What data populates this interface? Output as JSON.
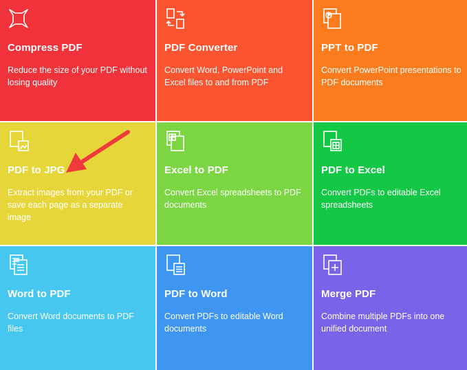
{
  "tiles": [
    {
      "title": "Compress PDF",
      "desc": "Reduce the size of your PDF without losing quality",
      "color": "#f0333a",
      "icon": "compress-icon"
    },
    {
      "title": "PDF Converter",
      "desc": "Convert Word, PowerPoint and Excel files to and from PDF",
      "color": "#fb5430",
      "icon": "convert-icon"
    },
    {
      "title": "PPT to PDF",
      "desc": "Convert PowerPoint presentations to PDF documents",
      "color": "#fb7c1f",
      "icon": "ppt-file-icon"
    },
    {
      "title": "PDF to JPG",
      "desc": "Extract images from your PDF or save each page as a separate image",
      "color": "#e6d63a",
      "icon": "image-file-icon"
    },
    {
      "title": "Excel to PDF",
      "desc": "Convert Excel spreadsheets to PDF documents",
      "color": "#7cd643",
      "icon": "excel-file-icon"
    },
    {
      "title": "PDF to Excel",
      "desc": "Convert PDFs to editable Excel spreadsheets",
      "color": "#12c844",
      "icon": "pdf-excel-icon"
    },
    {
      "title": "Word to PDF",
      "desc": "Convert Word documents to PDF files",
      "color": "#45c7ef",
      "icon": "word-file-icon"
    },
    {
      "title": "PDF to Word",
      "desc": "Convert PDFs to editable Word documents",
      "color": "#3e96f2",
      "icon": "pdf-word-icon"
    },
    {
      "title": "Merge PDF",
      "desc": "Combine multiple PDFs into one unified document",
      "color": "#7a63e8",
      "icon": "merge-icon"
    }
  ],
  "annotation": {
    "icon": "red-arrow-icon",
    "color": "#ef3b3b"
  }
}
